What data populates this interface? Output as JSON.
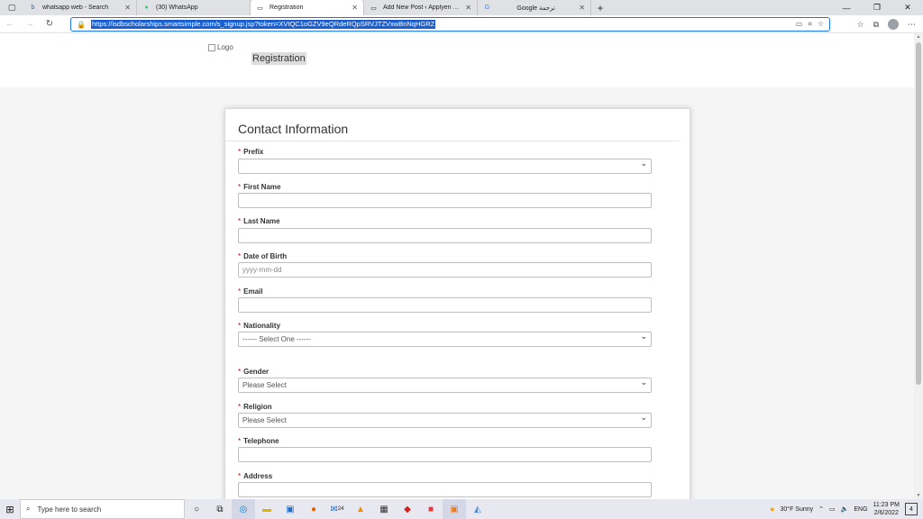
{
  "browser": {
    "tabs": [
      {
        "title": "whatsapp web - Search",
        "icon": "bing-icon",
        "active": false
      },
      {
        "title": "(30) WhatsApp",
        "icon": "whatsapp-icon",
        "active": false
      },
      {
        "title": "Registration",
        "icon": "page-icon",
        "active": true
      },
      {
        "title": "Add New Post ‹ Applyen — Wor...",
        "icon": "page-icon",
        "active": false
      },
      {
        "title": "Google ترجمة",
        "icon": "translate-icon",
        "active": false
      }
    ],
    "url": "https://isdbscholarships.smartsimple.com/s_signup.jsp?token=XVtQC1oGZV9eQRdeRQpSRVJTZVxwBnNqHGRZ"
  },
  "header": {
    "logo_alt": "Logo",
    "title": "Registration"
  },
  "form": {
    "title": "Contact Information",
    "fields": [
      {
        "label": "Prefix",
        "type": "select",
        "value": ""
      },
      {
        "label": "First Name",
        "type": "text",
        "value": ""
      },
      {
        "label": "Last Name",
        "type": "text",
        "value": ""
      },
      {
        "label": "Date of Birth",
        "type": "text",
        "placeholder": "yyyy-mm-dd"
      },
      {
        "label": "Email",
        "type": "text",
        "value": ""
      },
      {
        "label": "Nationality",
        "type": "select",
        "value": "------ Select One ------"
      },
      {
        "label": "Gender",
        "type": "select",
        "value": "Please Select"
      },
      {
        "label": "Religion",
        "type": "select",
        "value": "Please Select"
      },
      {
        "label": "Telephone",
        "type": "text",
        "value": ""
      },
      {
        "label": "Address",
        "type": "text",
        "value": ""
      }
    ],
    "required_mark": "*"
  },
  "taskbar": {
    "search_placeholder": "Type here to search",
    "weather": "30°F  Sunny",
    "language": "ENG",
    "time": "11:23 PM",
    "date": "2/6/2022",
    "mail_badge": "24",
    "notifications": "4"
  }
}
